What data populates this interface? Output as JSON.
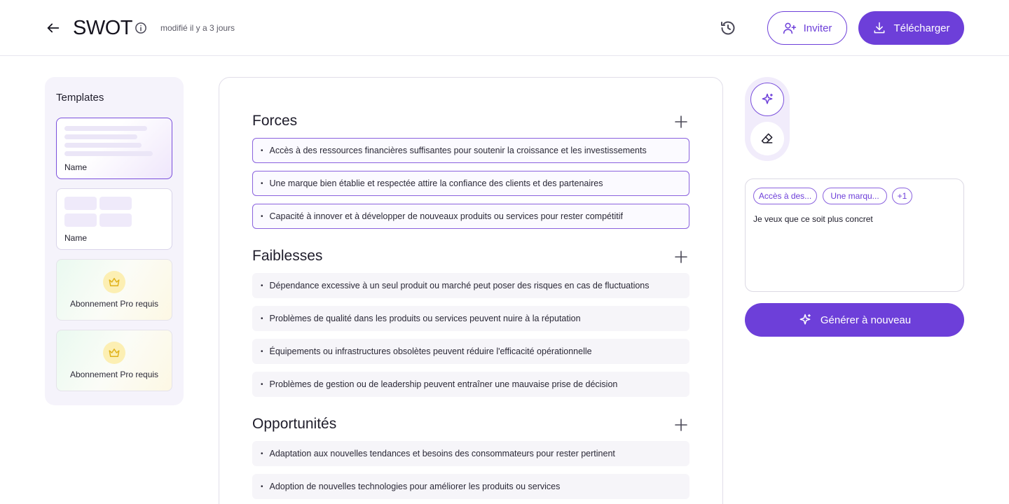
{
  "header": {
    "title": "SWOT",
    "modified": "modifié il y a 3 jours",
    "invite_label": "Inviter",
    "download_label": "Télécharger"
  },
  "templates": {
    "title": "Templates",
    "cards": [
      {
        "label": "Name",
        "kind": "lines",
        "selected": true
      },
      {
        "label": "Name",
        "kind": "grid",
        "selected": false
      },
      {
        "label": "Abonnement Pro requis",
        "kind": "pro",
        "selected": false
      },
      {
        "label": "Abonnement Pro requis",
        "kind": "pro",
        "selected": false
      }
    ]
  },
  "sections": [
    {
      "title": "Forces",
      "items": [
        "Accès à des ressources financières suffisantes pour soutenir la croissance et les investissements",
        "Une marque bien établie et respectée attire la confiance des clients et des partenaires",
        "Capacité à innover et à développer de nouveaux produits ou services pour rester compétitif"
      ]
    },
    {
      "title": "Faiblesses",
      "items": [
        "Dépendance excessive à un seul produit ou marché peut poser des risques en cas de fluctuations",
        "Problèmes de qualité dans les produits ou services peuvent nuire à la réputation",
        "Équipements ou infrastructures obsolètes peuvent réduire l'efficacité opérationnelle",
        "Problèmes de gestion ou de leadership peuvent entraîner une mauvaise prise de décision"
      ]
    },
    {
      "title": "Opportunités",
      "items": [
        "Adaptation aux nouvelles tendances et besoins des consommateurs pour rester pertinent",
        "Adoption de nouvelles technologies pour améliorer les produits ou services"
      ]
    }
  ],
  "ai_panel": {
    "chips": [
      "Accès à des...",
      "Une marqu...",
      "+1"
    ],
    "prompt_value": "Je veux que ce soit plus concret",
    "generate_label": "Générer à nouveau"
  },
  "colors": {
    "accent": "#6d3fd9",
    "accent_light": "#f1ecfb",
    "crown_bg": "#fcefb3",
    "crown_stroke": "#e0b21a"
  },
  "icons": {
    "back": "arrow-left-icon",
    "info": "info-icon",
    "history": "history-icon",
    "invite": "user-plus-icon",
    "download": "download-icon",
    "add": "plus-icon",
    "sparkle": "sparkle-icon",
    "eraser": "eraser-icon",
    "crown": "crown-icon"
  }
}
